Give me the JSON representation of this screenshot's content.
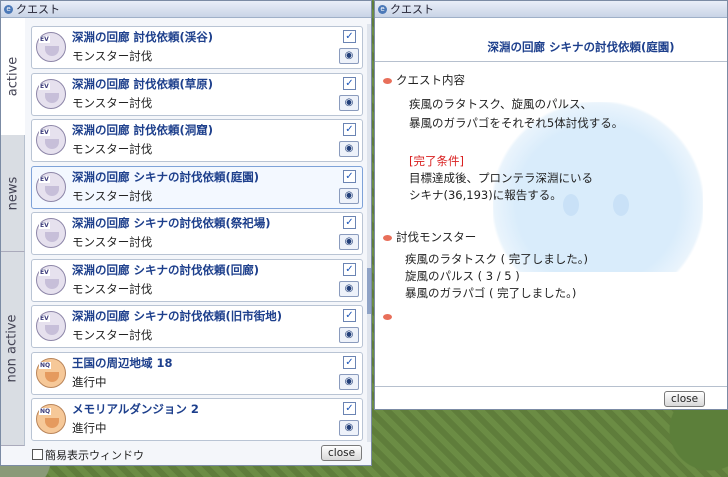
{
  "left_window": {
    "title": "クエスト",
    "tabs": [
      "active",
      "news",
      "non active"
    ],
    "quests": [
      {
        "title": "深淵の回廊 討伐依頼(渓谷)",
        "subtitle": "モンスター討伐",
        "icon": "ev-quest-icon",
        "checked": true
      },
      {
        "title": "深淵の回廊 討伐依頼(草原)",
        "subtitle": "モンスター討伐",
        "icon": "ev-quest-icon",
        "checked": true
      },
      {
        "title": "深淵の回廊 討伐依頼(洞窟)",
        "subtitle": "モンスター討伐",
        "icon": "ev-quest-icon",
        "checked": true
      },
      {
        "title": "深淵の回廊 シキナの討伐依頼(庭園)",
        "subtitle": "モンスター討伐",
        "icon": "ev-quest-icon",
        "checked": true
      },
      {
        "title": "深淵の回廊 シキナの討伐依頼(祭祀場)",
        "subtitle": "モンスター討伐",
        "icon": "ev-quest-icon",
        "checked": true
      },
      {
        "title": "深淵の回廊 シキナの討伐依頼(回廊)",
        "subtitle": "モンスター討伐",
        "icon": "ev-quest-icon",
        "checked": true
      },
      {
        "title": "深淵の回廊 シキナの討伐依頼(旧市街地)",
        "subtitle": "モンスター討伐",
        "icon": "ev-quest-icon",
        "checked": true
      },
      {
        "title": "王国の周辺地域 18",
        "subtitle": "進行中",
        "icon": "nq-quest-icon",
        "checked": true
      },
      {
        "title": "メモリアルダンジョン 2",
        "subtitle": "進行中",
        "icon": "nq-quest-icon",
        "checked": true
      }
    ],
    "footer": {
      "checkbox_label": "簡易表示ウィンドウ",
      "close_label": "close"
    }
  },
  "right_window": {
    "title": "クエスト",
    "quest_title": "深淵の回廊 シキナの討伐依頼(庭園)",
    "content_header": "クエスト内容",
    "content_lines": [
      "疾風のラタトスク、旋風のパルス、",
      "暴風のガラパゴをそれぞれ5体討伐する。"
    ],
    "complete_header": "[完了条件]",
    "complete_lines": [
      "目標達成後、プロンテラ深淵にいる",
      "シキナ(36,193)に報告する。"
    ],
    "monster_header": "討伐モンスター",
    "monsters": [
      "疾風のラタトスク ( 完了しました。)",
      "旋風のパルス ( 3 / 5 )",
      "暴風のガラパゴ ( 完了しました。)"
    ],
    "close_label": "close"
  }
}
